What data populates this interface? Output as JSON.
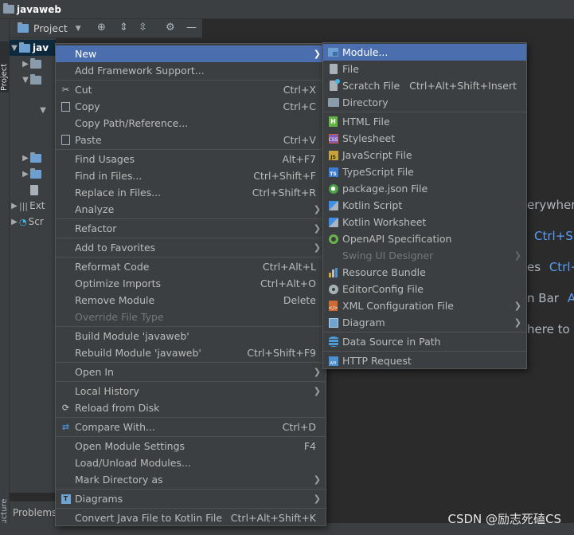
{
  "window": {
    "title": "javaweb"
  },
  "left_strip": {
    "project_tab": "Project",
    "structure_tab": "Structure"
  },
  "project_toolbar": {
    "label": "Project"
  },
  "tree": {
    "root_label": "jav",
    "items": [
      {
        "label": "Ext"
      },
      {
        "label": "Scr"
      }
    ]
  },
  "bottom": {
    "problems_label": "Problems"
  },
  "editor_hints": {
    "line1": "erywher",
    "line2_key": "Ctrl+Sh",
    "line3": "es",
    "line3_key": "Ctrl+",
    "line4": "n Bar",
    "line4_key": "A",
    "line5": "here to"
  },
  "main_menu": {
    "items": [
      {
        "label": "New",
        "arrow": true,
        "highlighted": true
      },
      {
        "label": "Add Framework Support..."
      },
      {
        "label": "Cut",
        "shortcut": "Ctrl+X",
        "icon": "scissors-icon"
      },
      {
        "label": "Copy",
        "shortcut": "Ctrl+C",
        "icon": "copy-icon"
      },
      {
        "label": "Copy Path/Reference..."
      },
      {
        "label": "Paste",
        "shortcut": "Ctrl+V",
        "icon": "clipboard-icon"
      },
      {
        "label": "Find Usages",
        "shortcut": "Alt+F7"
      },
      {
        "label": "Find in Files...",
        "shortcut": "Ctrl+Shift+F"
      },
      {
        "label": "Replace in Files...",
        "shortcut": "Ctrl+Shift+R"
      },
      {
        "label": "Analyze",
        "arrow": true
      },
      {
        "label": "Refactor",
        "arrow": true
      },
      {
        "label": "Add to Favorites",
        "arrow": true
      },
      {
        "label": "Reformat Code",
        "shortcut": "Ctrl+Alt+L"
      },
      {
        "label": "Optimize Imports",
        "shortcut": "Ctrl+Alt+O"
      },
      {
        "label": "Remove Module",
        "shortcut": "Delete"
      },
      {
        "label": "Override File Type",
        "disabled": true
      },
      {
        "label": "Build Module 'javaweb'"
      },
      {
        "label": "Rebuild Module 'javaweb'",
        "shortcut": "Ctrl+Shift+F9"
      },
      {
        "label": "Open In",
        "arrow": true
      },
      {
        "label": "Local History",
        "arrow": true
      },
      {
        "label": "Reload from Disk",
        "icon": "refresh-icon"
      },
      {
        "label": "Compare With...",
        "shortcut": "Ctrl+D",
        "icon": "compare-icon"
      },
      {
        "label": "Open Module Settings",
        "shortcut": "F4"
      },
      {
        "label": "Load/Unload Modules..."
      },
      {
        "label": "Mark Directory as",
        "arrow": true
      },
      {
        "label": "Diagrams",
        "arrow": true,
        "icon": "diagram-icon"
      },
      {
        "label": "Convert Java File to Kotlin File",
        "shortcut": "Ctrl+Alt+Shift+K"
      }
    ]
  },
  "new_submenu": {
    "items": [
      {
        "label": "Module...",
        "icon": "module-icon",
        "highlighted": true
      },
      {
        "label": "File",
        "icon": "file-icon"
      },
      {
        "label": "Scratch File",
        "shortcut": "Ctrl+Alt+Shift+Insert",
        "icon": "scratch-file-icon"
      },
      {
        "label": "Directory",
        "icon": "folder-icon"
      },
      {
        "label": "HTML File",
        "icon": "html-icon"
      },
      {
        "label": "Stylesheet",
        "icon": "css-icon"
      },
      {
        "label": "JavaScript File",
        "icon": "javascript-icon"
      },
      {
        "label": "TypeScript File",
        "icon": "typescript-icon"
      },
      {
        "label": "package.json File",
        "icon": "nodejs-icon"
      },
      {
        "label": "Kotlin Script",
        "icon": "kotlin-icon"
      },
      {
        "label": "Kotlin Worksheet",
        "icon": "kotlin-icon"
      },
      {
        "label": "OpenAPI Specification",
        "icon": "openapi-icon"
      },
      {
        "label": "Swing UI Designer",
        "arrow": true,
        "disabled": true
      },
      {
        "label": "Resource Bundle",
        "icon": "resource-bundle-icon"
      },
      {
        "label": "EditorConfig File",
        "icon": "editorconfig-icon"
      },
      {
        "label": "XML Configuration File",
        "arrow": true,
        "icon": "xml-icon"
      },
      {
        "label": "Diagram",
        "arrow": true,
        "icon": "diagram-icon"
      },
      {
        "label": "Data Source in Path",
        "icon": "database-icon"
      },
      {
        "label": "HTTP Request",
        "icon": "http-api-icon"
      }
    ]
  },
  "watermark": "CSDN @励志死磕CS",
  "colors": {
    "highlight": "#4b6eaf",
    "menu_bg": "#3c3f41",
    "editor_bg": "#2b2b2b",
    "link": "#589df6"
  }
}
